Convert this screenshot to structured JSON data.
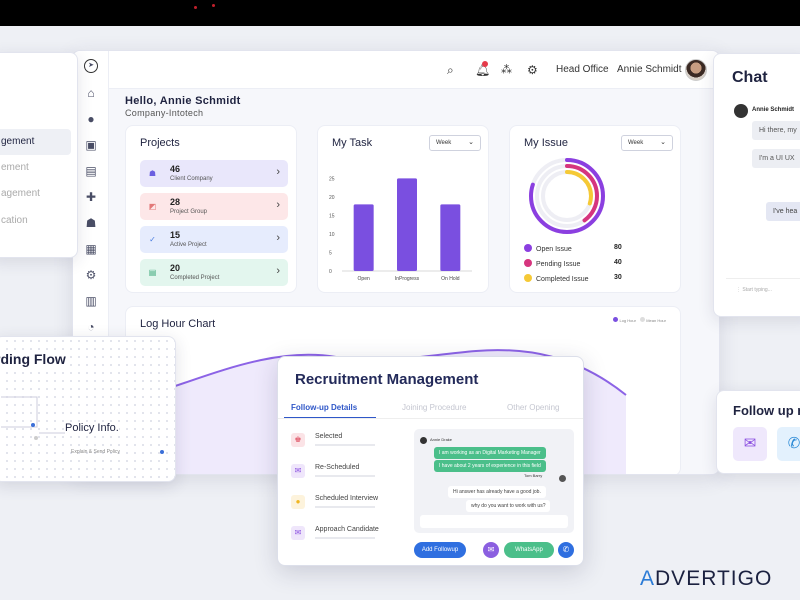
{
  "header": {
    "office": "Head Office",
    "user": "Annie Schmidt"
  },
  "greeting": {
    "hello": "Hello, Annie Schmidt",
    "company": "Company-Intotech"
  },
  "left_panel": {
    "items": [
      "",
      "gement",
      "ement",
      "agement",
      "cation"
    ]
  },
  "projects": {
    "title": "Projects",
    "rows": [
      {
        "count": "46",
        "label": "Client Company",
        "color": "#e9e7fb"
      },
      {
        "count": "28",
        "label": "Project Group",
        "color": "#fde7e8"
      },
      {
        "count": "15",
        "label": "Active Project",
        "color": "#e6ecfd"
      },
      {
        "count": "20",
        "label": "Completed Project",
        "color": "#e3f6ee"
      }
    ]
  },
  "my_task": {
    "title": "My Task",
    "filter": "Week",
    "chart_data": {
      "type": "bar",
      "categories": [
        "Open",
        "InProgress",
        "On Hold"
      ],
      "values": [
        18,
        25,
        18
      ],
      "yticks": [
        "25",
        "20",
        "15",
        "10",
        "5",
        "0"
      ],
      "ylim": [
        0,
        27
      ],
      "color": "#7a4fe0"
    }
  },
  "my_issue": {
    "title": "My Issue",
    "filter": "Week",
    "chart_data": {
      "type": "donut",
      "series": [
        {
          "name": "Open Issue",
          "value": 80,
          "color": "#8b3fe0"
        },
        {
          "name": "Pending Issue",
          "value": 40,
          "color": "#d6357e"
        },
        {
          "name": "Completed Issue",
          "value": 30,
          "color": "#f5c936"
        }
      ]
    }
  },
  "log_hour": {
    "title": "Log Hour Chart",
    "legend": [
      "Log Hour",
      "Mean Hour"
    ]
  },
  "onboarding": {
    "title": "rding Flow",
    "node_title": "Policy Info.",
    "node_sub": "Explain & Send Policy"
  },
  "chat": {
    "title": "Chat",
    "user": "Annie Schmidt",
    "messages": [
      "Hi there, my",
      "I'm a UI UX",
      "I've hea"
    ],
    "input_placeholder": "Start typing..."
  },
  "follow": {
    "title": "Follow up m"
  },
  "recruitment": {
    "title": "Recruitment Management",
    "tabs": [
      "Follow-up Details",
      "Joining Procedure",
      "Other Opening"
    ],
    "items": [
      {
        "label": "Selected",
        "color": "#fbe3e6",
        "icon_color": "#e05a6b"
      },
      {
        "label": "Re-Scheduled",
        "color": "#efe6fb",
        "icon_color": "#8b4fe0"
      },
      {
        "label": "Scheduled Interview",
        "color": "#fdf3dc",
        "icon_color": "#f0b622"
      },
      {
        "label": "Approach Candidate",
        "color": "#efe6fb",
        "icon_color": "#8b4fe0"
      }
    ],
    "chat": {
      "from": "Annie Drake",
      "to": "Tom Barry",
      "green": [
        "I am working as an Digital Marketing Manager",
        "I have about 2 years of experience in this field"
      ],
      "white": [
        "Hi answer has already have a good job.",
        "why do you want to work with us?"
      ]
    },
    "buttons": {
      "followup": "Add Followup",
      "whatsapp": "WhatsApp"
    }
  },
  "brand": {
    "text": "DVERTIGO",
    "mark": "A"
  }
}
